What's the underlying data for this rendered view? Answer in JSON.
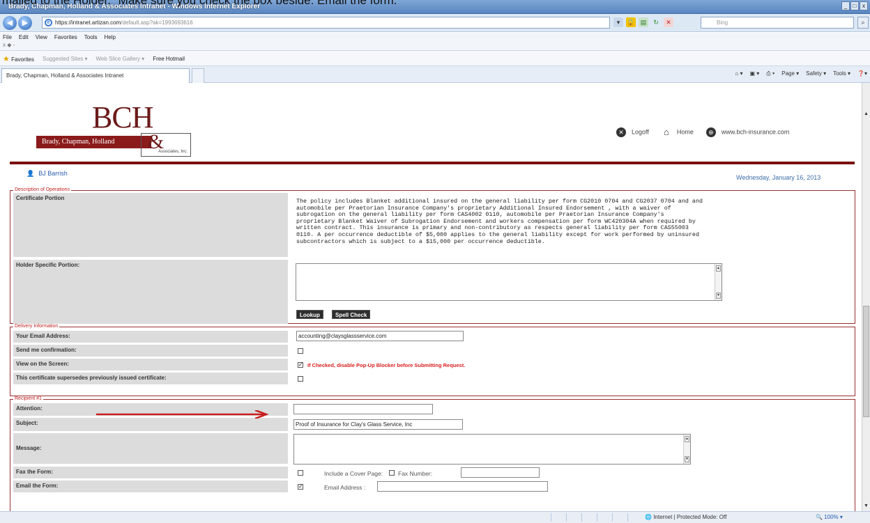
{
  "cutoff_text": "mailed to the Holder.\" Make sure you check the box beside: Email the form.",
  "window": {
    "title": "Brady, Chapman, Holland & Associates Intranet - Windows Internet Explorer",
    "controls": [
      "_",
      "□",
      "x"
    ]
  },
  "address_bar": {
    "url_host": "https://intranet.artizan.com",
    "url_path": "/default.asp?ak=1993693616",
    "search_placeholder": "Bing"
  },
  "menu": {
    "items": [
      "File",
      "Edit",
      "View",
      "Favorites",
      "Tools",
      "Help"
    ],
    "sub": "x ◆ -"
  },
  "favorites_bar": {
    "label": "Favorites",
    "items": [
      "Suggested Sites ▾",
      "Web Slice Gallery ▾",
      "Free Hotmail"
    ]
  },
  "tab": {
    "title": "Brady, Chapman, Holland & Associates Intranet"
  },
  "command_bar": [
    "Page ▾",
    "Safety ▾",
    "Tools ▾",
    "▾"
  ],
  "header": {
    "logo_text": "BCH",
    "logo_band": "Brady, Chapman, Holland",
    "logo_amp": "&",
    "logo_assoc": "Associates, Inc.",
    "links": {
      "logoff": "Logoff",
      "home": "Home",
      "website": "www.bch-insurance.com"
    },
    "user": "BJ Barrish",
    "date": "Wednesday, January 16, 2013"
  },
  "description_section": {
    "legend": "Description of Operations",
    "certificate_label": "Certificate Portion",
    "certificate_text": [
      "The policy includes Blanket additional insured on the general liability per form CG2010 0704 and CG2037 0704 and and",
      "automobile per Praetorian Insurance Company's proprietary Additional Insured Endorsement , with a waiver of",
      "subrogation on the general liability per form CAS4002 0110, automobile per Praetorian Insurance Company's",
      "proprietary Blanket Waiver of Subrogation Endorsement and workers compensation per form WC420304A when required by",
      "written contract. This insurance is primary and non-contributory as respects general liability per form CAS55003",
      "0110. A per occurrence deductible of $5,000 applies to the general liability except for work performed by uninsured",
      "subcontractors which is subject to a $15,000 per occurrence deductible."
    ],
    "holder_label": "Holder Specific Portion:",
    "holder_value": "",
    "lookup_button": "Lookup",
    "spellcheck_button": "Spell Check"
  },
  "delivery_section": {
    "legend": "Delivery Information",
    "email_label": "Your Email Address:",
    "email_value": "accounting@claysglassservice.com",
    "send_confirm_label": "Send me confirmation:",
    "send_confirm_checked": false,
    "view_screen_label": "View on the Screen:",
    "view_screen_checked": true,
    "view_screen_warning": "If Checked, disable Pop-Up Blocker before Submitting Request.",
    "supersede_label": "This certificate supersedes previously issued certificate:",
    "supersede_checked": false
  },
  "recipient_section": {
    "legend": "Recipient #1",
    "attention_label": "Attention:",
    "attention_value": "",
    "subject_label": "Subject:",
    "subject_value": "Proof of Insurance for Clay's Glass Service, Inc",
    "message_label": "Message:",
    "message_value": "",
    "fax_label": "Fax the Form:",
    "fax_checked": false,
    "cover_page_label": "Include a Cover Page:",
    "cover_page_checked": false,
    "fax_number_label": "Fax Number:",
    "fax_number_value": "",
    "email_form_label": "Email the Form:",
    "email_form_checked": true,
    "email_address_label": "Email Address :",
    "email_address_value": ""
  },
  "status_bar": {
    "zone": "Internet | Protected Mode: Off",
    "zoom": "🔍 100%  ▾"
  },
  "colors": {
    "brand_red": "#7a1111",
    "legend_red": "#c02020",
    "arrow_red": "#c81e1e",
    "link_blue": "#2a5db0"
  }
}
